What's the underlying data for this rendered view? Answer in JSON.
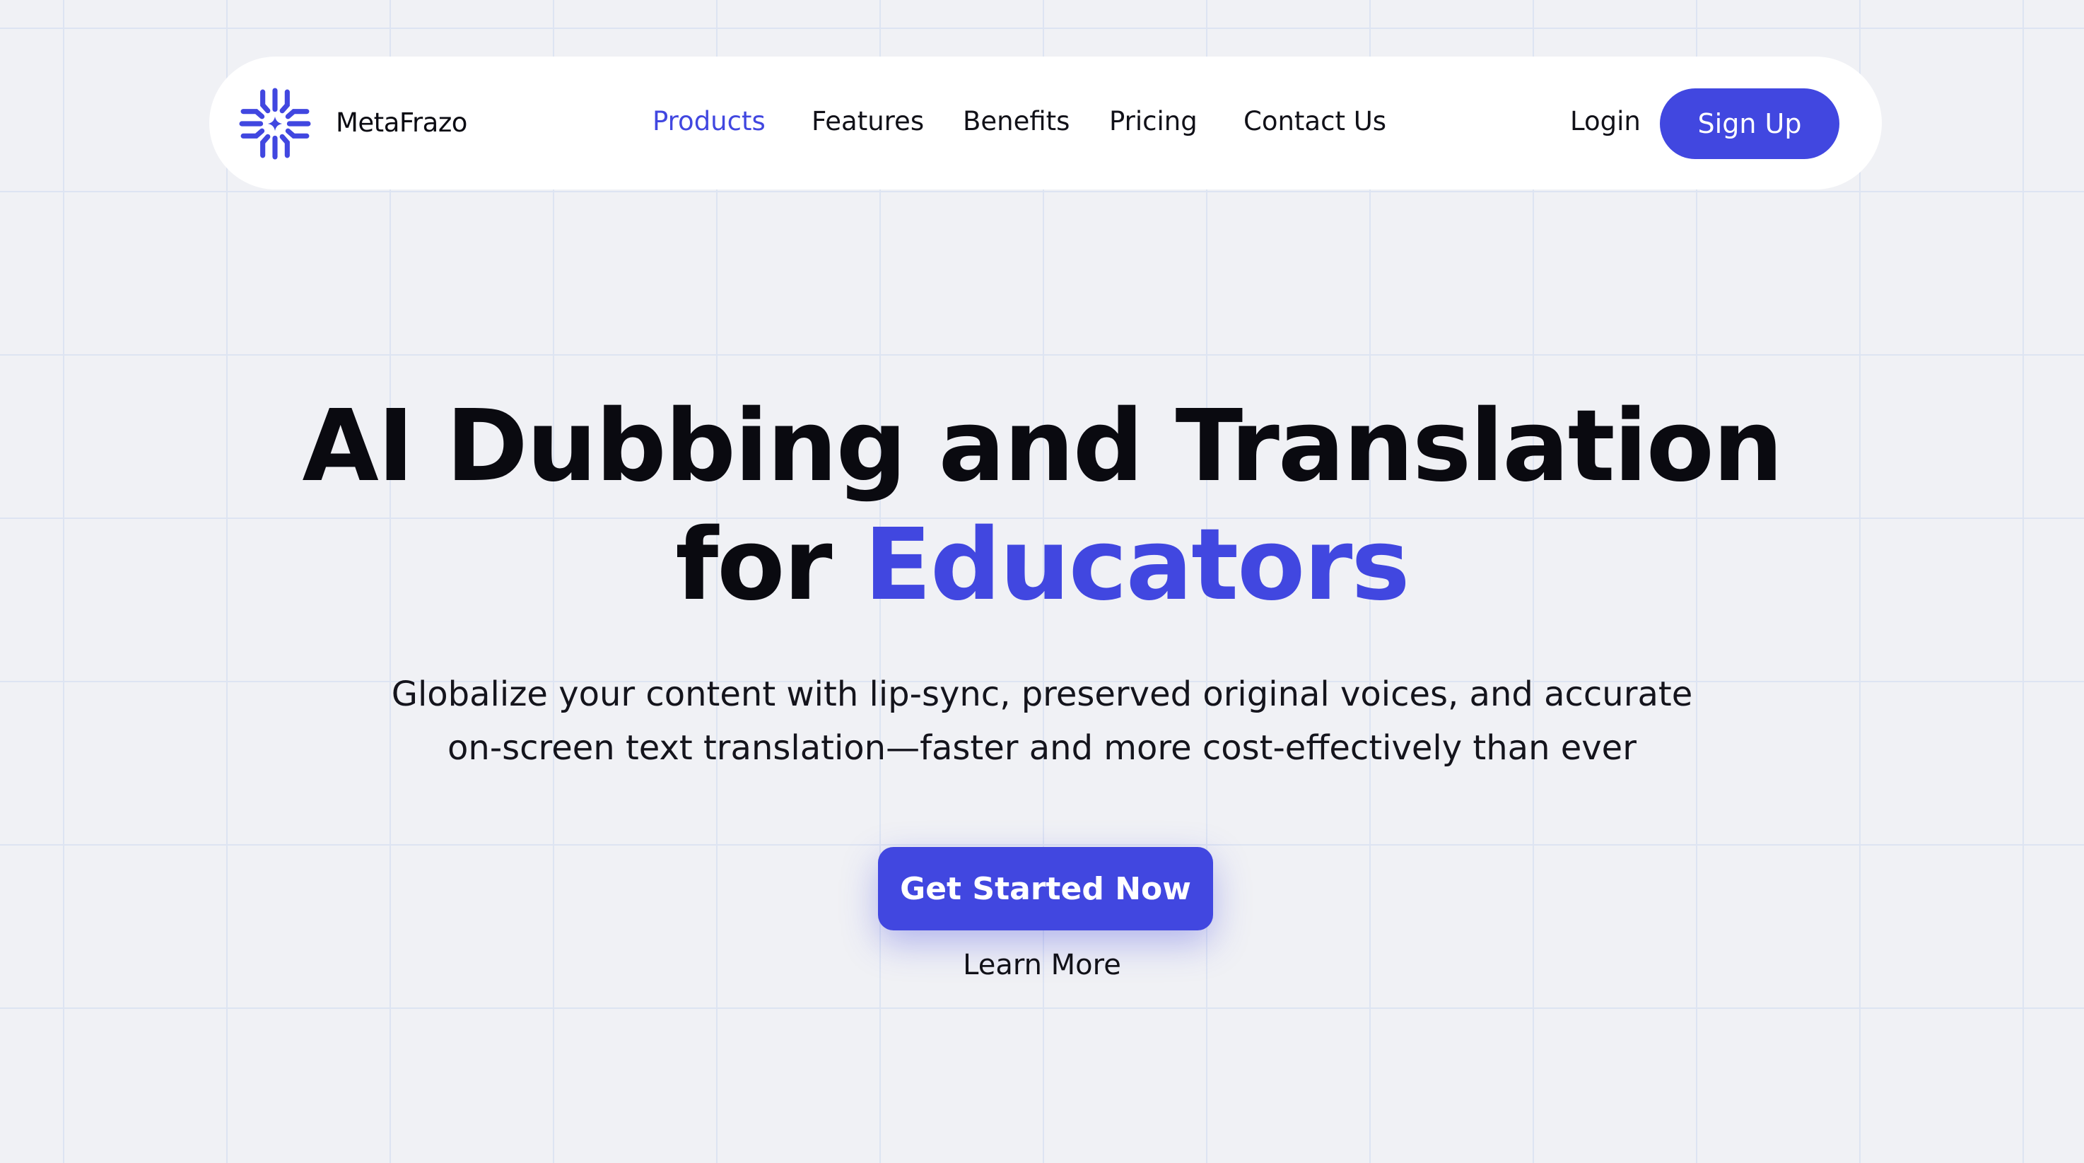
{
  "brand": {
    "name": "MetaFrazo",
    "logo_icon": "sparkle-snowflake-logo",
    "accent_color": "#4147e0"
  },
  "nav": {
    "links": [
      {
        "label": "Products",
        "active": true
      },
      {
        "label": "Features",
        "active": false
      },
      {
        "label": "Benefits",
        "active": false
      },
      {
        "label": "Pricing",
        "active": false
      },
      {
        "label": "Contact Us",
        "active": false
      }
    ],
    "login_label": "Login",
    "signup_label": "Sign Up"
  },
  "hero": {
    "title_line1": "AI Dubbing and Translation",
    "title_line2_prefix": "for ",
    "title_line2_accent": "Educators",
    "subtitle_line1": "Globalize your content with lip-sync, preserved original voices, and accurate",
    "subtitle_line2": "on-screen text translation—faster and more cost-effectively than ever",
    "cta_label": "Get Started Now",
    "secondary_label": "Learn More"
  },
  "colors": {
    "background": "#f0f1f5",
    "grid_line": "#dde4f2",
    "text": "#0b0b12"
  }
}
